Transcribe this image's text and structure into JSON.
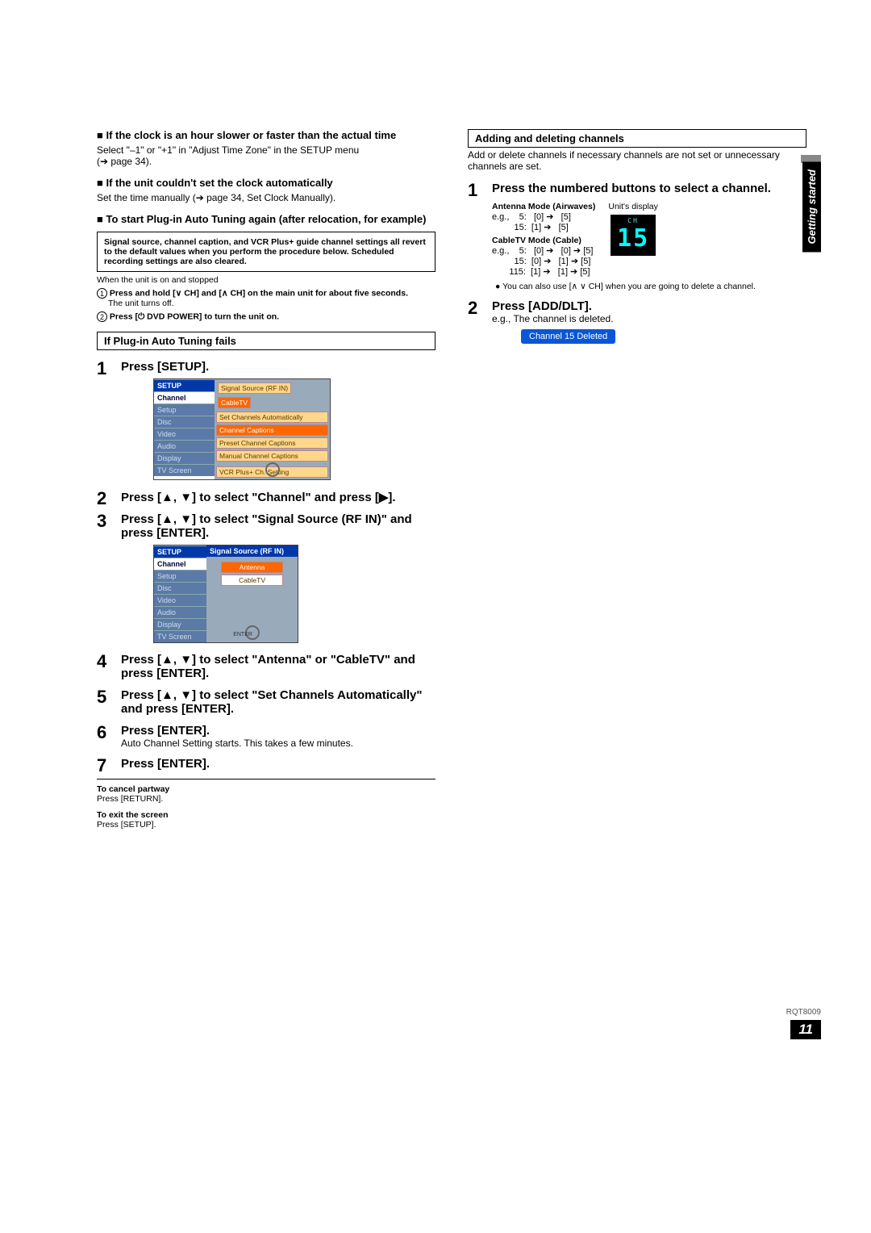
{
  "sideTab": "Getting started",
  "docId": "RQT8009",
  "pageNum": "11",
  "left": {
    "h1_title": "If the clock is an hour slower or faster than the actual time",
    "h1_body1": "Select \"–1\" or \"+1\" in \"Adjust Time Zone\" in the SETUP menu",
    "h1_body2": "(➔ page 34).",
    "h2_title": "If the unit couldn't set the clock automatically",
    "h2_body": "Set the time manually (➔ page 34, Set Clock Manually).",
    "h3_title": "To start Plug-in Auto Tuning again (after relocation, for example)",
    "warnbox": "Signal source, channel caption, and VCR Plus+ guide channel settings all revert to the default values when you perform the procedure below. Scheduled recording settings are also cleared.",
    "pre1": "When the unit is on and stopped",
    "circ1_bold": "Press and hold [∨ CH] and [∧ CH] on the main unit for about five seconds.",
    "circ1_sub": "The unit turns off.",
    "circ2_bold": "Press [⏻ DVD POWER] to turn the unit on.",
    "failbox": "If Plug-in Auto Tuning fails",
    "steps": {
      "s1": "Press [SETUP].",
      "s2": "Press [▲, ▼] to select \"Channel\" and press [▶].",
      "s3": "Press [▲, ▼] to select \"Signal Source (RF IN)\" and press [ENTER].",
      "s4": "Press [▲, ▼] to select \"Antenna\" or \"CableTV\" and press [ENTER].",
      "s5": "Press [▲, ▼] to select \"Set Channels Automatically\" and press [ENTER].",
      "s6": "Press [ENTER].",
      "s6sub": "Auto Channel Setting starts. This takes a few minutes.",
      "s7": "Press [ENTER]."
    },
    "menu1": {
      "title": "SETUP",
      "left": [
        "Channel",
        "Setup",
        "Disc",
        "Video",
        "Audio",
        "Display",
        "TV Screen"
      ],
      "rline1a": "Signal Source (RF IN)",
      "rline1b": "CableTV",
      "rline2": "Set Channels Automatically",
      "rline3": "Channel Captions",
      "rline4": "Preset Channel Captions",
      "rline5": "Manual Channel Captions",
      "rline6": "VCR Plus+ Ch. Setting"
    },
    "menu2": {
      "title": "SETUP",
      "left": [
        "Channel",
        "Setup",
        "Disc",
        "Video",
        "Audio",
        "Display",
        "TV Screen"
      ],
      "rtitle": "Signal Source (RF IN)",
      "opt1": "Antenna",
      "opt2": "CableTV",
      "enter": "ENTER"
    },
    "cancel_t": "To cancel partway",
    "cancel_b": "Press [RETURN].",
    "exit_t": "To exit the screen",
    "exit_b": "Press [SETUP]."
  },
  "right": {
    "boxhead": "Adding and deleting channels",
    "intro": "Add or delete channels if necessary channels are not set or unnecessary channels are set.",
    "s1": "Press the numbered buttons to select a channel.",
    "ant_t": "Antenna Mode (Airwaves)",
    "ant_l1": "e.g.,    5:   [0] ➔   [5]",
    "ant_l2": "         15:  [1] ➔   [5]",
    "cab_t": "CableTV Mode (Cable)",
    "cab_l1": "e.g.,    5:   [0] ➔   [0] ➔ [5]",
    "cab_l2": "         15:  [0] ➔   [1] ➔ [5]",
    "cab_l3": "       115:  [1] ➔   [1] ➔ [5]",
    "unitlbl": "Unit's display",
    "unitCH": "CH",
    "unitNum": "15",
    "note": "● You can also use [∧ ∨ CH] when you are going to delete a channel.",
    "s2": "Press [ADD/DLT].",
    "s2sub": "e.g., The channel is deleted.",
    "pill": "Channel 15 Deleted"
  }
}
